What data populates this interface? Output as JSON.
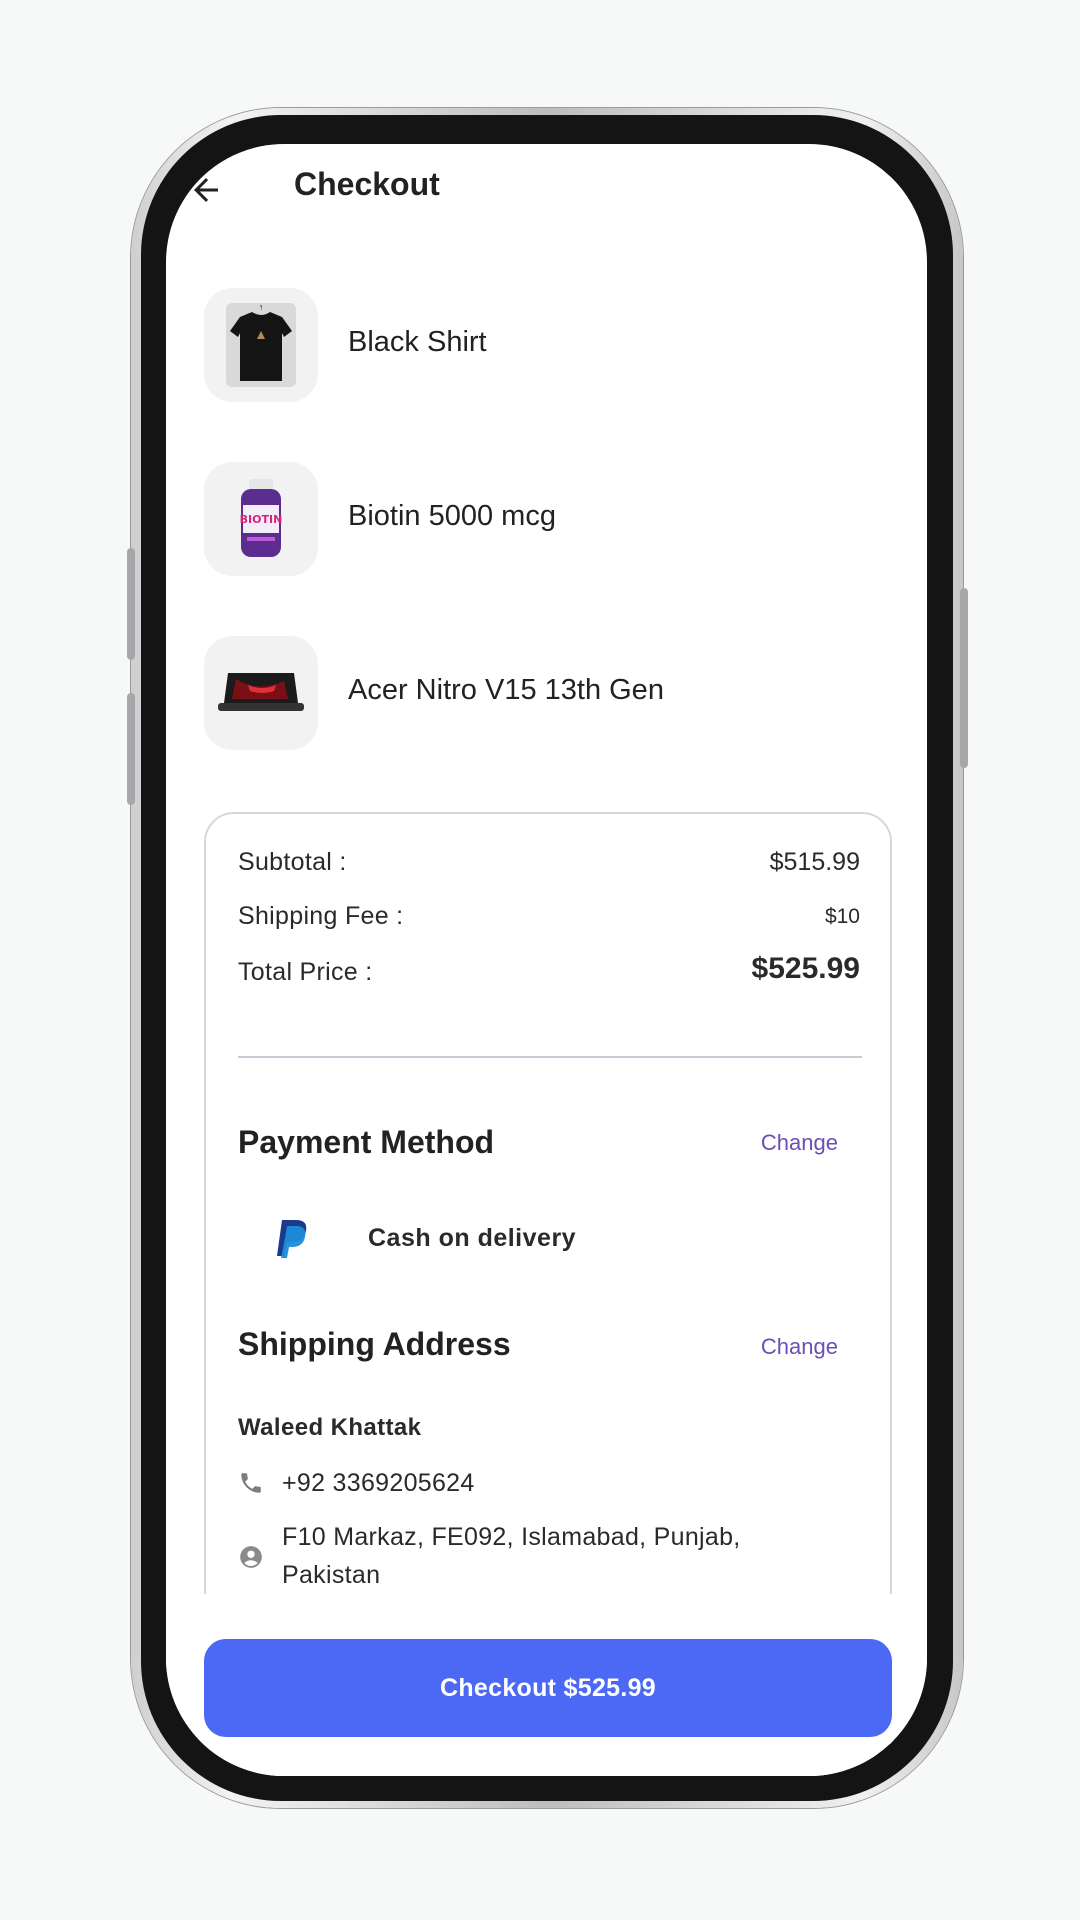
{
  "header": {
    "title": "Checkout"
  },
  "products": [
    {
      "name": "Black Shirt",
      "icon": "t-shirt-icon"
    },
    {
      "name": "Biotin 5000 mcg",
      "icon": "supplement-bottle-icon"
    },
    {
      "name": "Acer Nitro V15 13th Gen",
      "icon": "laptop-icon"
    }
  ],
  "summary": {
    "subtotal_label": "Subtotal :",
    "subtotal_value": "$515.99",
    "shipping_label": "Shipping Fee :",
    "shipping_value": "$10",
    "total_label": "Total Price :",
    "total_value": "$525.99"
  },
  "payment": {
    "title": "Payment Method",
    "change_label": "Change",
    "method": "Cash on delivery",
    "icon": "paypal-icon"
  },
  "shipping": {
    "title": "Shipping Address",
    "change_label": "Change",
    "name": "Waleed Khattak",
    "phone": "+92 3369205624",
    "address_line1": "F10 Markaz, FE092, Islamabad, Punjab,",
    "address_line2": "Pakistan"
  },
  "checkout_button": {
    "label": "Checkout $525.99"
  },
  "colors": {
    "accent": "#4b69f5",
    "link": "#6a4fb6"
  }
}
